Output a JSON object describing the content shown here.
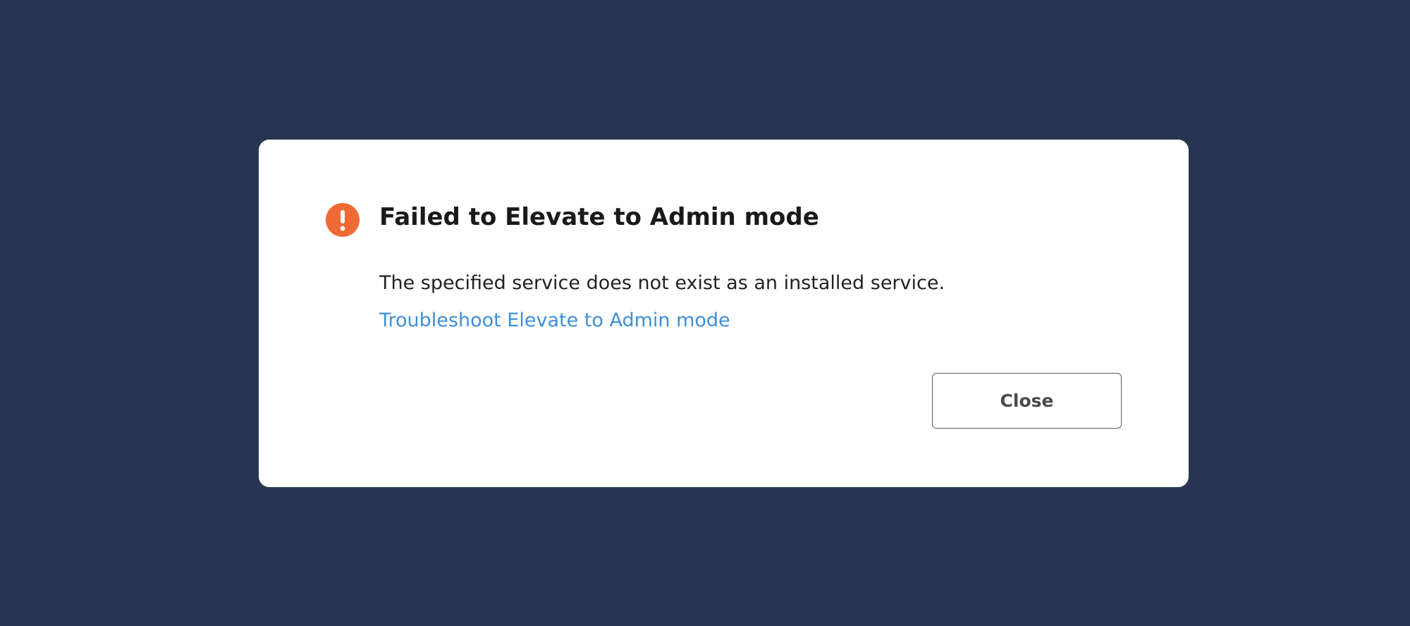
{
  "dialog": {
    "title": "Failed to Elevate to Admin mode",
    "message": "The specified service does not exist as an installed service.",
    "help_link": "Troubleshoot Elevate to Admin mode",
    "close_label": "Close",
    "icon": "exclamation-circle-icon"
  },
  "colors": {
    "backdrop": "#283552",
    "dialog_background": "#ffffff",
    "alert_icon": "#f06a35",
    "link": "#3e8fd8"
  }
}
